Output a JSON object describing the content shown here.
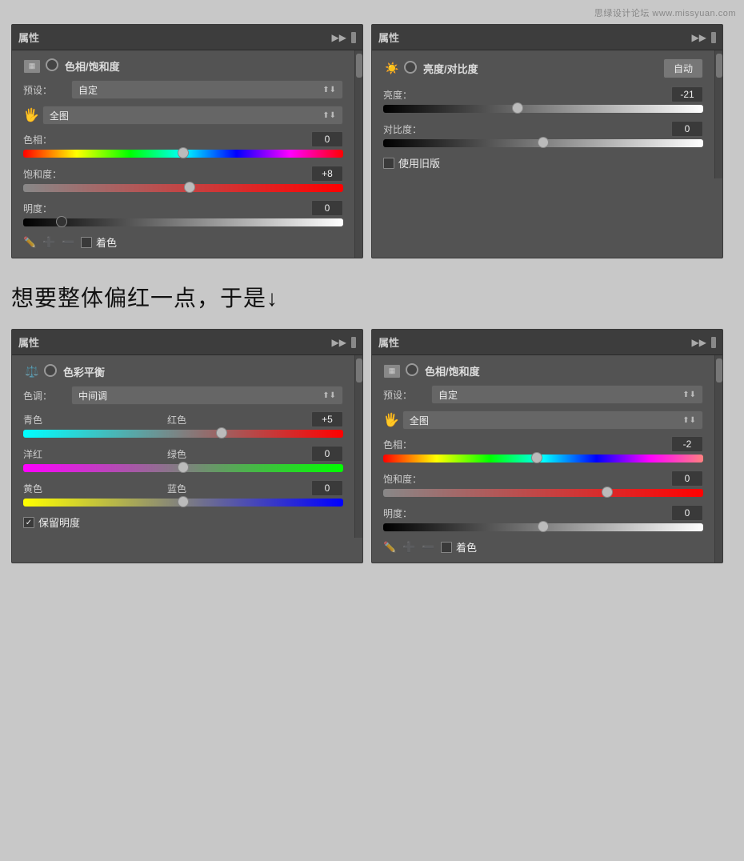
{
  "watermark": "思绿设计论坛 www.missyuan.com",
  "panel1": {
    "title": "属性",
    "icon_type": "hue",
    "label": "色相/饱和度",
    "preset_label": "预设：",
    "preset_value": "自定",
    "hand_label": "全图",
    "sliders": [
      {
        "name": "色相：",
        "value": "0",
        "thumb_pct": 50,
        "type": "hue"
      },
      {
        "name": "饱和度：",
        "value": "+8",
        "thumb_pct": 52,
        "type": "sat"
      },
      {
        "name": "明度：",
        "value": "0",
        "thumb_pct": 12,
        "type": "lig"
      }
    ],
    "colorize_label": "着色"
  },
  "panel2": {
    "title": "属性",
    "icon_type": "bright",
    "label": "亮度/对比度",
    "auto_label": "自动",
    "sliders": [
      {
        "name": "亮度：",
        "value": "-21",
        "thumb_pct": 42,
        "type": "bright"
      },
      {
        "name": "对比度：",
        "value": "0",
        "thumb_pct": 50,
        "type": "bright"
      }
    ],
    "legacy_label": "使用旧版"
  },
  "middle_text": "想要整体偏红一点，于是↓",
  "panel3": {
    "title": "属性",
    "icon_type": "balance",
    "label": "色彩平衡",
    "tone_label": "色调：",
    "tone_value": "中间调",
    "sliders": [
      {
        "left": "青色",
        "right": "红色",
        "value": "+5",
        "thumb_pct": 62,
        "type": "cyan-red"
      },
      {
        "left": "洋红",
        "right": "绿色",
        "value": "0",
        "thumb_pct": 50,
        "type": "magenta-green"
      },
      {
        "left": "黄色",
        "right": "蓝色",
        "value": "0",
        "thumb_pct": 50,
        "type": "yellow-blue"
      }
    ],
    "preserve_label": "保留明度",
    "preserve_checked": true
  },
  "panel4": {
    "title": "属性",
    "icon_type": "hue",
    "label": "色相/饱和度",
    "preset_label": "预设：",
    "preset_value": "自定",
    "hand_label": "全图",
    "sliders": [
      {
        "name": "色相：",
        "value": "-2",
        "thumb_pct": 48,
        "type": "hue2"
      },
      {
        "name": "饱和度：",
        "value": "0",
        "thumb_pct": 70,
        "type": "sat2"
      },
      {
        "name": "明度：",
        "value": "0",
        "thumb_pct": 50,
        "type": "lig2"
      }
    ],
    "colorize_label": "着色"
  }
}
